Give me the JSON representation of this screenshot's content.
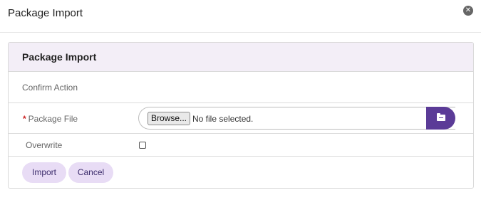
{
  "modal": {
    "title": "Package Import",
    "close_icon": "close-circle-icon"
  },
  "panel": {
    "title": "Package Import",
    "confirm_text": "Confirm Action"
  },
  "form": {
    "package_file": {
      "required_marker": "*",
      "label": "Package File",
      "browse_label": "Browse...",
      "status_text": "No file selected.",
      "folder_icon": "folder-icon"
    },
    "overwrite": {
      "label": "Overwrite",
      "checked": false
    }
  },
  "actions": {
    "import_label": "Import",
    "cancel_label": "Cancel"
  },
  "colors": {
    "accent": "#5b3b97",
    "button_bg": "#e8dcf5",
    "panel_heading_bg": "#f3eef7",
    "required": "#cc2222"
  }
}
